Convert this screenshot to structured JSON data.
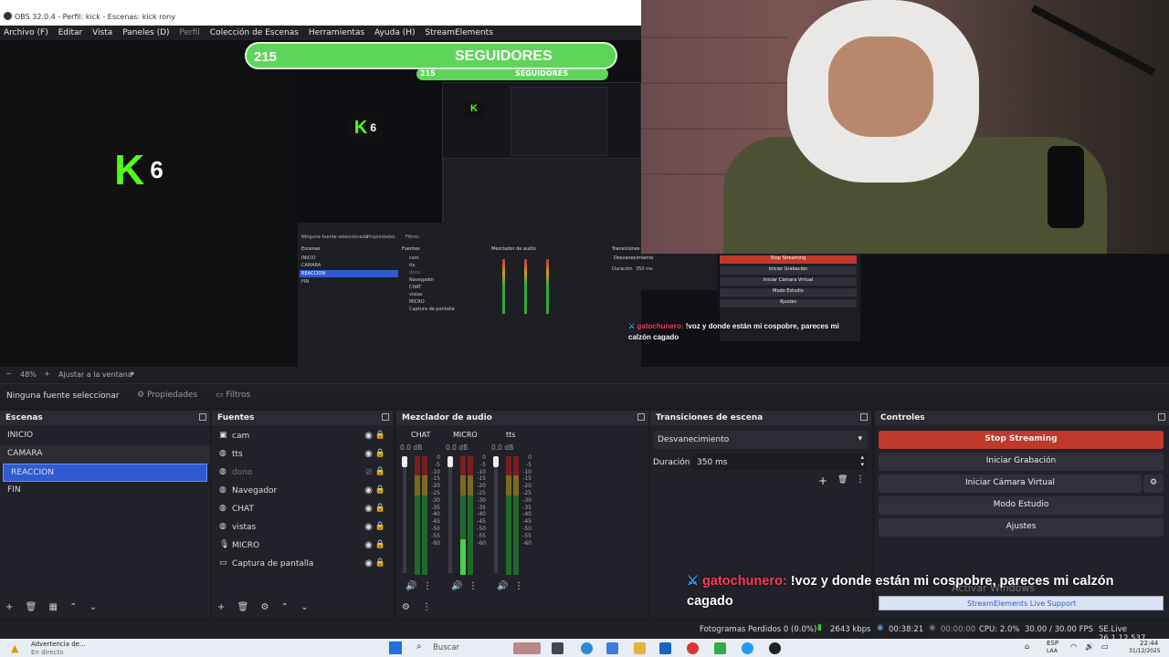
{
  "window": {
    "title": "OBS 32.0.4 - Perfil: kick - Escenas: kick rony"
  },
  "menu": {
    "items": [
      "Archivo (F)",
      "Editar",
      "Vista",
      "Paneles (D)",
      "Perfil",
      "Colección de Escenas",
      "Herramientas",
      "Ayuda (H)",
      "StreamElements"
    ]
  },
  "overlay": {
    "followers_count": "215",
    "followers_label": "SEGUIDORES",
    "kick_number": "6"
  },
  "preview_status": {
    "zoom": "48%",
    "fit_label": "Ajustar a la ventana"
  },
  "source_toolbar": {
    "no_source": "Ninguna fuente seleccionar",
    "properties": "Propiedades",
    "filters": "Filtros"
  },
  "nested_preview": {
    "followers_count": "215",
    "followers_label": "SEGUIDORES",
    "no_source": "Ninguna fuente seleccionada",
    "properties": "Propiedades",
    "filters": "Filtros",
    "scenes_header": "Escenas",
    "sources_header": "Fuentes",
    "mixer_header": "Mezclador de audio",
    "transitions_header": "Transiciones",
    "scenes": [
      "INICIO",
      "CAMARA",
      "REACCION",
      "FIN"
    ],
    "sources": [
      "cam",
      "tts",
      "dono",
      "Navegador",
      "CHAT",
      "vistas",
      "MICRO",
      "Captura de pantalla"
    ],
    "transition": "Desvanecimiento",
    "duration_label": "Duración",
    "duration_value": "350 ms",
    "controls": [
      "Stop Streaming",
      "Iniciar Grabación",
      "Iniciar Cámara Virtual",
      "Modo Estudio",
      "Ajustes"
    ],
    "chat_user": "gatochunero:",
    "chat_message": "!voz y donde están mi cospobre, pareces mi calzón cagado"
  },
  "scenes": {
    "header": "Escenas",
    "items": [
      {
        "label": "INICIO",
        "selected": false
      },
      {
        "label": "CAMARA",
        "selected": false
      },
      {
        "label": "REACCION",
        "selected": true
      },
      {
        "label": "FIN",
        "selected": false
      }
    ]
  },
  "sources": {
    "header": "Fuentes",
    "items": [
      {
        "label": "cam",
        "icon": "camera-icon",
        "visible": true
      },
      {
        "label": "tts",
        "icon": "globe-icon",
        "visible": true
      },
      {
        "label": "dono",
        "icon": "globe-icon",
        "visible": false
      },
      {
        "label": "Navegador",
        "icon": "globe-icon",
        "visible": true
      },
      {
        "label": "CHAT",
        "icon": "globe-icon",
        "visible": true
      },
      {
        "label": "vistas",
        "icon": "globe-icon",
        "visible": true
      },
      {
        "label": "MICRO",
        "icon": "microphone-icon",
        "visible": true
      },
      {
        "label": "Captura de pantalla",
        "icon": "monitor-icon",
        "visible": true
      }
    ]
  },
  "mixer": {
    "header": "Mezclador de audio",
    "channels": [
      {
        "name": "CHAT",
        "db": "0.0 dB"
      },
      {
        "name": "MICRO",
        "db": "0.0 dB"
      },
      {
        "name": "tts",
        "db": "0.0 dB"
      }
    ],
    "scale": [
      "0",
      "-5",
      "-10",
      "-15",
      "-20",
      "-25",
      "-30",
      "-35",
      "-40",
      "-45",
      "-50",
      "-55",
      "-60"
    ]
  },
  "transitions": {
    "header": "Transiciones de escena",
    "selected": "Desvanecimiento",
    "duration_label": "Duración",
    "duration_value": "350 ms"
  },
  "controls": {
    "header": "Controles",
    "stop_streaming": "Stop Streaming",
    "start_recording": "Iniciar Grabación",
    "virtual_camera": "Iniciar Cámara Virtual",
    "studio_mode": "Modo Estudio",
    "settings": "Ajustes"
  },
  "chat_overlay": {
    "user": "gatochunero:",
    "message": "!voz y donde están mi cospobre, pareces mi calzón cagado",
    "watermark": "Activar Windows",
    "support": "StreamElements Live Support"
  },
  "statusbar": {
    "dropped": "Fotogramas Perdidos 0 (0.0%)",
    "bitrate": "2643 kbps",
    "stream_time": "00:38:21",
    "rec_time": "00:00:00",
    "cpu": "CPU: 2.0%",
    "fps": "30.00 / 30.00 FPS",
    "version": "SE.Live 26.1.12.537"
  },
  "taskbar": {
    "warning": "Advertencia de...",
    "warning_sub": "En directo",
    "search": "Buscar",
    "lang": "ESP",
    "lang_sub": "LAA",
    "time": "22:44",
    "date": "31/12/2025"
  },
  "colors": {
    "accent": "#2f5bd2",
    "stream_button": "#c0392b",
    "kick_green": "#53fc18",
    "followers_bar": "#5fd45a",
    "chat_user": "#ff3b5c"
  }
}
